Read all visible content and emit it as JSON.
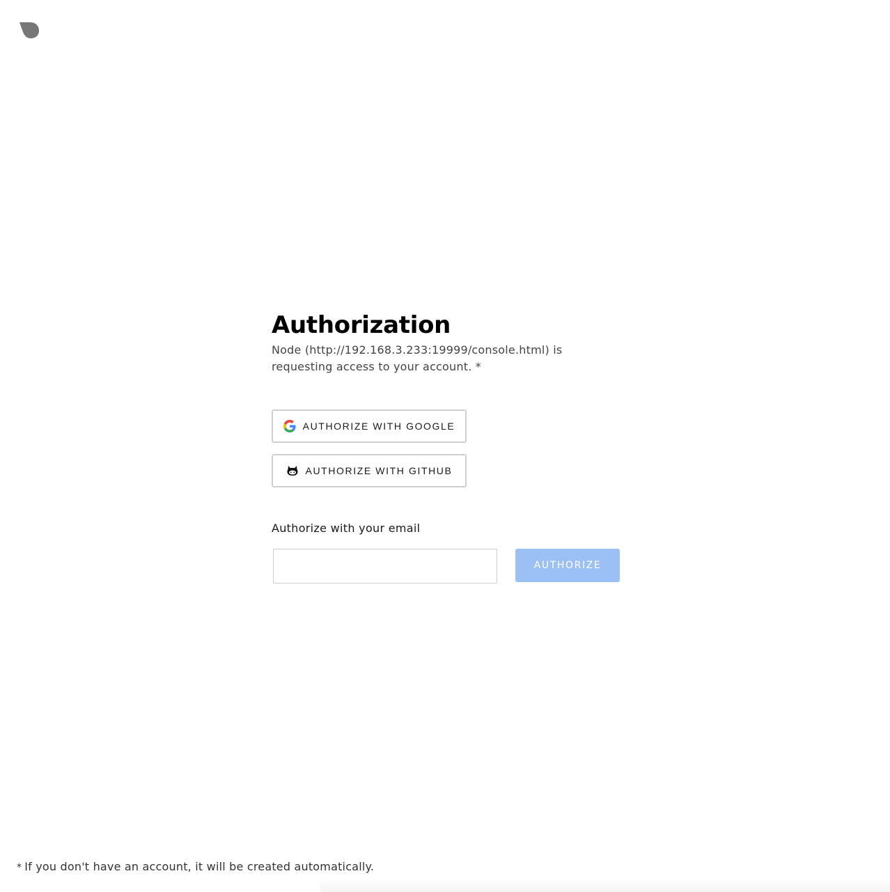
{
  "logo": {
    "icon": "leaf-logo-icon",
    "color": "#777777"
  },
  "main": {
    "title": "Authorization",
    "description": "Node (http://192.168.3.233:19999/console.html) is requesting access to your account. *"
  },
  "oauth": {
    "google_label": "AUTHORIZE WITH GOOGLE",
    "google_icon": "google-icon",
    "github_label": "AUTHORIZE WITH GITHUB",
    "github_icon": "github-icon"
  },
  "email": {
    "label": "Authorize with your email",
    "value": "",
    "placeholder": "",
    "button_label": "AUTHORIZE",
    "button_color": "#9dc0f4"
  },
  "footnote": {
    "star": "*",
    "text": "If you don't have an account, it will be created automatically."
  }
}
